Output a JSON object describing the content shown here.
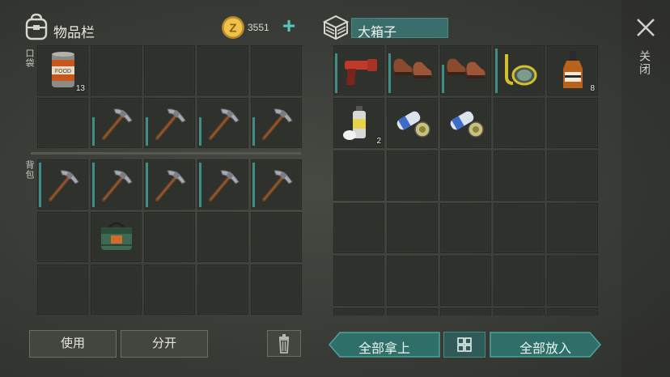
{
  "inventory": {
    "title": "物品栏",
    "coins": "3551",
    "pocket_label": "口袋",
    "backpack_label": "背包",
    "pocket_slots": [
      {
        "item": "canned-food",
        "count": "13",
        "durability": null
      },
      {
        "item": null
      },
      {
        "item": null
      },
      {
        "item": null
      },
      {
        "item": null
      },
      {
        "item": null
      },
      {
        "item": "pickaxe",
        "durability": 0.6
      },
      {
        "item": "pickaxe",
        "durability": 0.6
      },
      {
        "item": "pickaxe",
        "durability": 0.6
      },
      {
        "item": "pickaxe",
        "durability": 0.6
      }
    ],
    "backpack_slots": [
      {
        "item": "pickaxe",
        "durability": 0.95
      },
      {
        "item": "pickaxe",
        "durability": 0.95
      },
      {
        "item": "pickaxe",
        "durability": 0.95
      },
      {
        "item": "pickaxe",
        "durability": 0.95
      },
      {
        "item": "pickaxe",
        "durability": 0.95
      },
      {
        "item": null
      },
      {
        "item": "green-bag"
      },
      {
        "item": null
      },
      {
        "item": null
      },
      {
        "item": null
      },
      {
        "item": null
      },
      {
        "item": null
      },
      {
        "item": null
      },
      {
        "item": null
      },
      {
        "item": null
      }
    ],
    "use_label": "使用",
    "split_label": "分开"
  },
  "box": {
    "title": "大箱子",
    "slots": [
      {
        "item": "flare-gun",
        "durability": 0.85
      },
      {
        "item": "leather-shoes",
        "durability": 0.85
      },
      {
        "item": "leather-shoes",
        "durability": 0.6
      },
      {
        "item": "snorkel-mask",
        "durability": 0.95
      },
      {
        "item": "whiskey-bottle",
        "count": "8"
      },
      {
        "item": "spray-paint",
        "count": "2"
      },
      {
        "item": "magazine-rolls"
      },
      {
        "item": "magazine-rolls"
      },
      {
        "item": null
      },
      {
        "item": null
      },
      {
        "item": null
      },
      {
        "item": null
      },
      {
        "item": null
      },
      {
        "item": null
      },
      {
        "item": null
      },
      {
        "item": null
      },
      {
        "item": null
      },
      {
        "item": null
      },
      {
        "item": null
      },
      {
        "item": null
      },
      {
        "item": null
      },
      {
        "item": null
      },
      {
        "item": null
      },
      {
        "item": null
      },
      {
        "item": null
      },
      {
        "item": null
      },
      {
        "item": null
      },
      {
        "item": null
      },
      {
        "item": null
      },
      {
        "item": null
      }
    ],
    "take_all_label": "全部拿上",
    "put_all_label": "全部放入"
  },
  "close_label": "关闭",
  "colors": {
    "accent": "#4fa39b",
    "coin": "#e0b23a"
  }
}
